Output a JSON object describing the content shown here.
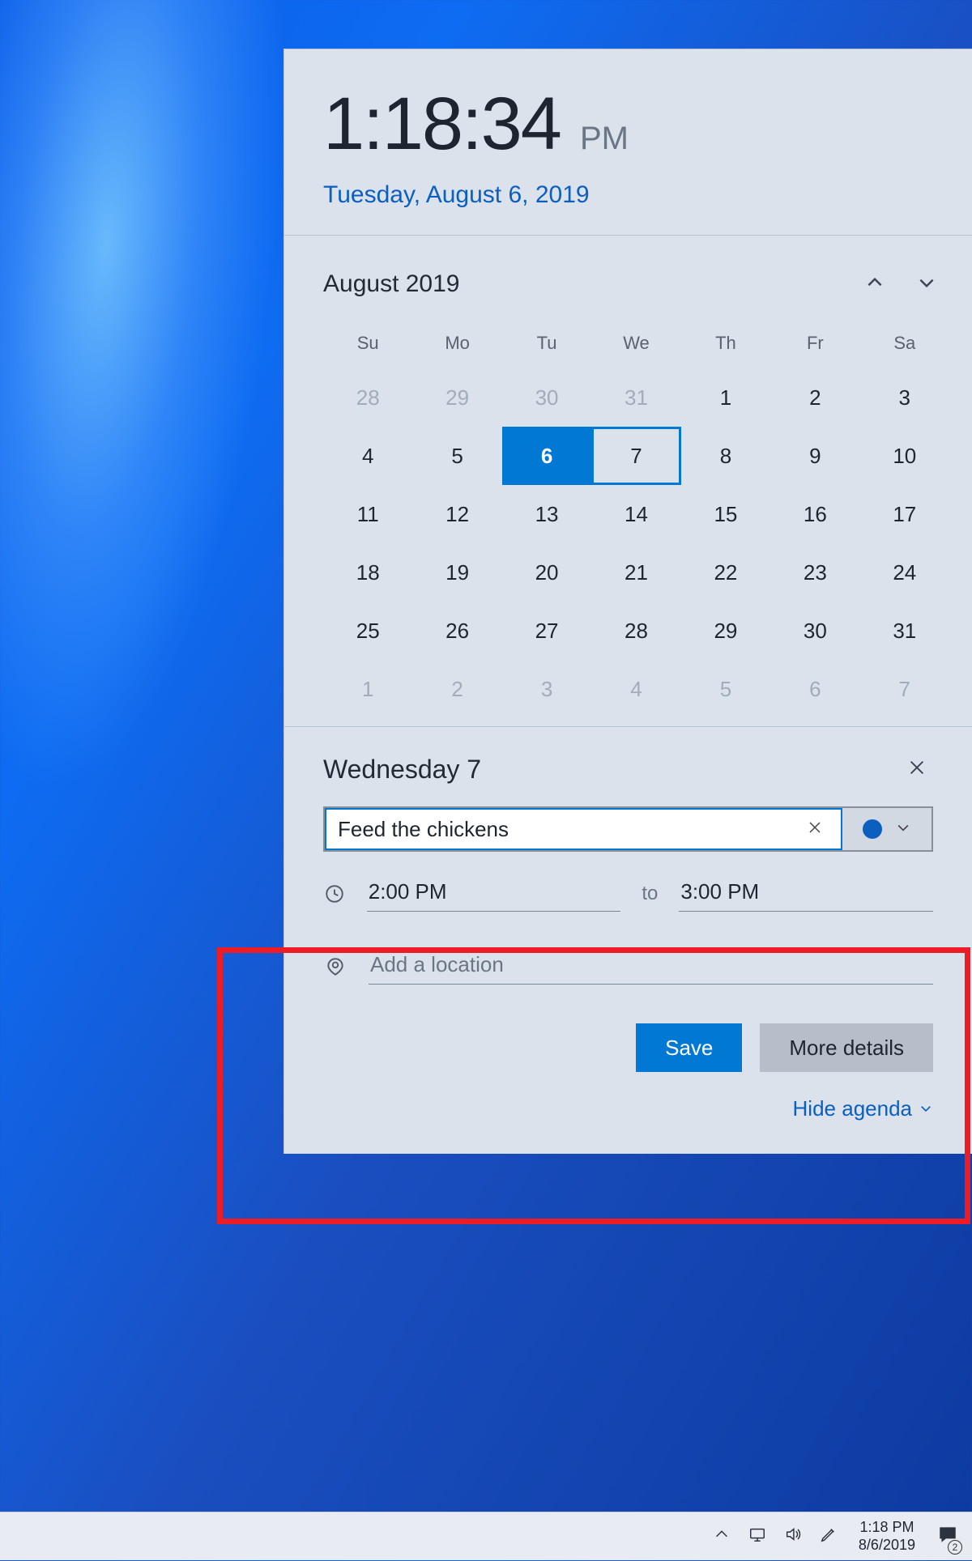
{
  "clock": {
    "time": "1:18:34",
    "ampm": "PM",
    "date": "Tuesday, August 6, 2019"
  },
  "calendar": {
    "month_label": "August 2019",
    "weekdays": [
      "Su",
      "Mo",
      "Tu",
      "We",
      "Th",
      "Fr",
      "Sa"
    ],
    "cells": [
      {
        "n": "28",
        "other": true
      },
      {
        "n": "29",
        "other": true
      },
      {
        "n": "30",
        "other": true
      },
      {
        "n": "31",
        "other": true
      },
      {
        "n": "1"
      },
      {
        "n": "2"
      },
      {
        "n": "3"
      },
      {
        "n": "4"
      },
      {
        "n": "5"
      },
      {
        "n": "6",
        "today": true
      },
      {
        "n": "7",
        "selected": true
      },
      {
        "n": "8"
      },
      {
        "n": "9"
      },
      {
        "n": "10"
      },
      {
        "n": "11"
      },
      {
        "n": "12"
      },
      {
        "n": "13"
      },
      {
        "n": "14"
      },
      {
        "n": "15"
      },
      {
        "n": "16"
      },
      {
        "n": "17"
      },
      {
        "n": "18"
      },
      {
        "n": "19"
      },
      {
        "n": "20"
      },
      {
        "n": "21"
      },
      {
        "n": "22"
      },
      {
        "n": "23"
      },
      {
        "n": "24"
      },
      {
        "n": "25"
      },
      {
        "n": "26"
      },
      {
        "n": "27"
      },
      {
        "n": "28"
      },
      {
        "n": "29"
      },
      {
        "n": "30"
      },
      {
        "n": "31"
      },
      {
        "n": "1",
        "other": true
      },
      {
        "n": "2",
        "other": true
      },
      {
        "n": "3",
        "other": true
      },
      {
        "n": "4",
        "other": true
      },
      {
        "n": "5",
        "other": true
      },
      {
        "n": "6",
        "other": true
      },
      {
        "n": "7",
        "other": true
      }
    ]
  },
  "event": {
    "day_label": "Wednesday 7",
    "name_value": "Feed the chickens",
    "color": "#0a5fbf",
    "start_time": "2:00 PM",
    "to_label": "to",
    "end_time": "3:00 PM",
    "location_placeholder": "Add a location",
    "save_label": "Save",
    "details_label": "More details",
    "hide_agenda_label": "Hide agenda"
  },
  "taskbar": {
    "time": "1:18 PM",
    "date": "8/6/2019",
    "notification_count": "2"
  }
}
